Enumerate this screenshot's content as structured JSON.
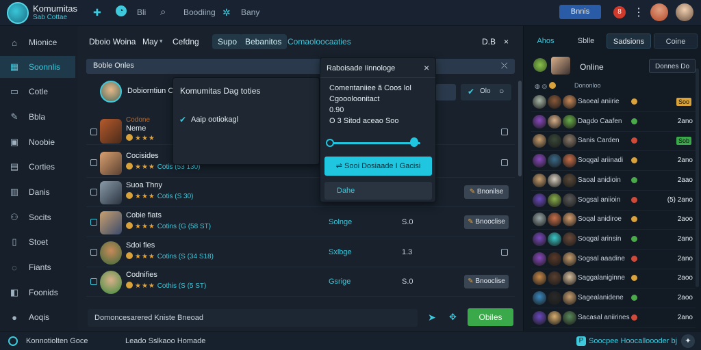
{
  "app": {
    "title": "Komumitas",
    "subtitle": "Sab Cottae"
  },
  "topbar": {
    "items": [
      "Bli",
      "Boodiing",
      "Bany"
    ],
    "button": "Bnnis",
    "notif": "8",
    "kebab": "⋮"
  },
  "sidebar": {
    "items": [
      {
        "label": "Mionice",
        "icon": "home-icon"
      },
      {
        "label": "Soonnlis",
        "icon": "grid-icon",
        "active": true
      },
      {
        "label": "Cotle",
        "icon": "tile-icon"
      },
      {
        "label": "Bbla",
        "icon": "pen-icon"
      },
      {
        "label": "Noobie",
        "icon": "lock-icon"
      },
      {
        "label": "Corties",
        "icon": "folder-icon"
      },
      {
        "label": "Danis",
        "icon": "card-icon"
      },
      {
        "label": "Socits",
        "icon": "people-icon"
      },
      {
        "label": "Stoet",
        "icon": "book-icon"
      },
      {
        "label": "Fiants",
        "icon": "bell-icon"
      },
      {
        "label": "Foonids",
        "icon": "shield-icon"
      },
      {
        "label": "Aoqis",
        "icon": "globe-icon"
      }
    ]
  },
  "main": {
    "tabs": [
      "Dboio Woina",
      "May",
      "Cefdng",
      "Supo",
      "Bebanitos",
      "Comaoloocaaties"
    ],
    "header_right": "D.B",
    "close": "×",
    "filter_label": "Boble Onles",
    "filter_close": "⤫",
    "profile_name": "Dobiorntiun Co",
    "search_btn": "Olo",
    "rows": [
      {
        "name": "Neme",
        "sub": "Codone",
        "status": "",
        "num": "",
        "btn": "",
        "checked": false
      },
      {
        "name": "Cocisides",
        "sub": "Cotis (53 130)",
        "status": "",
        "num": "",
        "btn": "",
        "checked": false
      },
      {
        "name": "Suoa Thny",
        "sub": "Cotis (S 30)",
        "status": "",
        "num": "",
        "btn": "Bnonilse",
        "checked": false
      },
      {
        "name": "Cobie fiats",
        "sub": "Cotins (G (58 ST)",
        "status": "Solnge",
        "num": "S.0",
        "btn": "Bnooclise",
        "checked": true
      },
      {
        "name": "Sdoi fies",
        "sub": "Cotins (S (34 S18)",
        "status": "Sxlbge",
        "num": "1.3",
        "btn": "",
        "checked": false
      },
      {
        "name": "Codnifies",
        "sub": "Cothis (S (5 ST)",
        "status": "Gsrige",
        "num": "S.0",
        "btn": "Bnooclise",
        "checked": true
      }
    ],
    "bottom_input": "Domoncesarered Kniste Bneoad",
    "send_btn": "Obiles"
  },
  "popup1": {
    "title": "Komumitas Dag toties",
    "item": "Aaip ootiokagl"
  },
  "popup2": {
    "title": "Raboisade Iinnologe",
    "close": "×",
    "lines": [
      "Comentaniiee ã Coos lol",
      "Cgoooloonitact",
      "0.90",
      "O 3 Sitod aceao Soo"
    ],
    "slider_value": 0.93,
    "primary_btn": "Sooi Dosiaade I Gacisi",
    "secondary_btn": "Dahe"
  },
  "right": {
    "tabs": [
      "Ahos",
      "Sblle",
      "Sadsions",
      "Coine"
    ],
    "online_label": "Online",
    "online_btn": "Donnes Do",
    "subheader": "Dononloo",
    "rows": [
      {
        "name": "Saoeal aniirie",
        "val": "",
        "badge": "Soo"
      },
      {
        "name": "Dagdo Caafen",
        "val": "2ano",
        "badge": ""
      },
      {
        "name": "Sanis Carden",
        "val": "",
        "badge": "Sob"
      },
      {
        "name": "Soqgal ariinadi",
        "val": "2ano",
        "badge": ""
      },
      {
        "name": "Saoal anidioin",
        "val": "2aao",
        "badge": ""
      },
      {
        "name": "Sogsal aniioin",
        "val": "(5) 2ano",
        "badge": ""
      },
      {
        "name": "Soqal anidiroe",
        "val": "2aoo",
        "badge": ""
      },
      {
        "name": "Soqgal arinsin",
        "val": "2ano",
        "badge": ""
      },
      {
        "name": "Sogsal aaadine",
        "val": "2ano",
        "badge": ""
      },
      {
        "name": "Saggalaniginne",
        "val": "2aoo",
        "badge": ""
      },
      {
        "name": "Sagealanidene",
        "val": "2aoo",
        "badge": ""
      },
      {
        "name": "Sacasal aniirines",
        "val": "2ano",
        "badge": ""
      }
    ]
  },
  "statusbar": {
    "left": "Konnotiolten Goce",
    "middle": "Leado Sslkaoo Homade",
    "right": "Soocpee Hoocalloooder bj"
  },
  "colors": {
    "accent": "#3ec9dc",
    "green": "#3aa94a",
    "primary_btn": "#20c6e0",
    "top_btn": "#2a5ba6"
  }
}
